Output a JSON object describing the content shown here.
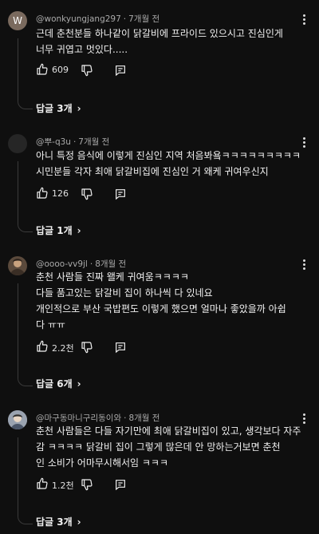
{
  "comments": [
    {
      "avatar_letter": "W",
      "avatar_color": "#7a6a5e",
      "author": "@wonkyungjang297",
      "time": "7개월 전",
      "lines": [
        "근데 춘천분들 하나같이 닭갈비에 프라이드 있으시고 진심인게",
        "너무 귀엽고 멋있다....."
      ],
      "likes": "609",
      "replies": "답글 3개"
    },
    {
      "avatar_letter": "",
      "avatar_color": "#2a2a2a",
      "author": "@뿌-q3u",
      "time": "7개월 전",
      "lines": [
        "아니 특정 음식에 이렇게 진심인 지역 처음봐욬ㅋㅋㅋㅋㅋㅋㅋㅋㅋ",
        "시민분들 각자 최애 닭갈비집에 진심인 거 왜케 귀여우신지"
      ],
      "likes": "126",
      "replies": "답글 1개"
    },
    {
      "avatar_letter": "",
      "avatar_color": "#5b4a3c",
      "author": "@oooo-vv9jl",
      "time": "8개월 전",
      "lines": [
        "춘천 사람들 진짜 왤케 귀여움ㅋㅋㅋㅋ",
        "다들 품고있는 닭갈비 집이 하나씩 다 있네요",
        "개인적으로 부산 국밥편도 이렇게 했으면 얼마나 좋았을까 아쉽",
        "다 ㅠㅠ"
      ],
      "likes": "2.2천",
      "replies": "답글 6개"
    },
    {
      "avatar_letter": "",
      "avatar_color": "#8a8f9a",
      "author": "@마구동마니구리동이와",
      "time": "8개월 전",
      "lines": [
        "춘천 사람들은 다들 자기만에 최애 닭갈비집이 있고, 생각보다 자주",
        "감 ㅋㅋㅋㅋ 닭갈비 집이 그렇게 많은데 안 망하는거보면 춘천",
        "인 소비가 어마무시해서임 ㅋㅋㅋ"
      ],
      "likes": "1.2천",
      "replies": "답글 3개"
    }
  ]
}
